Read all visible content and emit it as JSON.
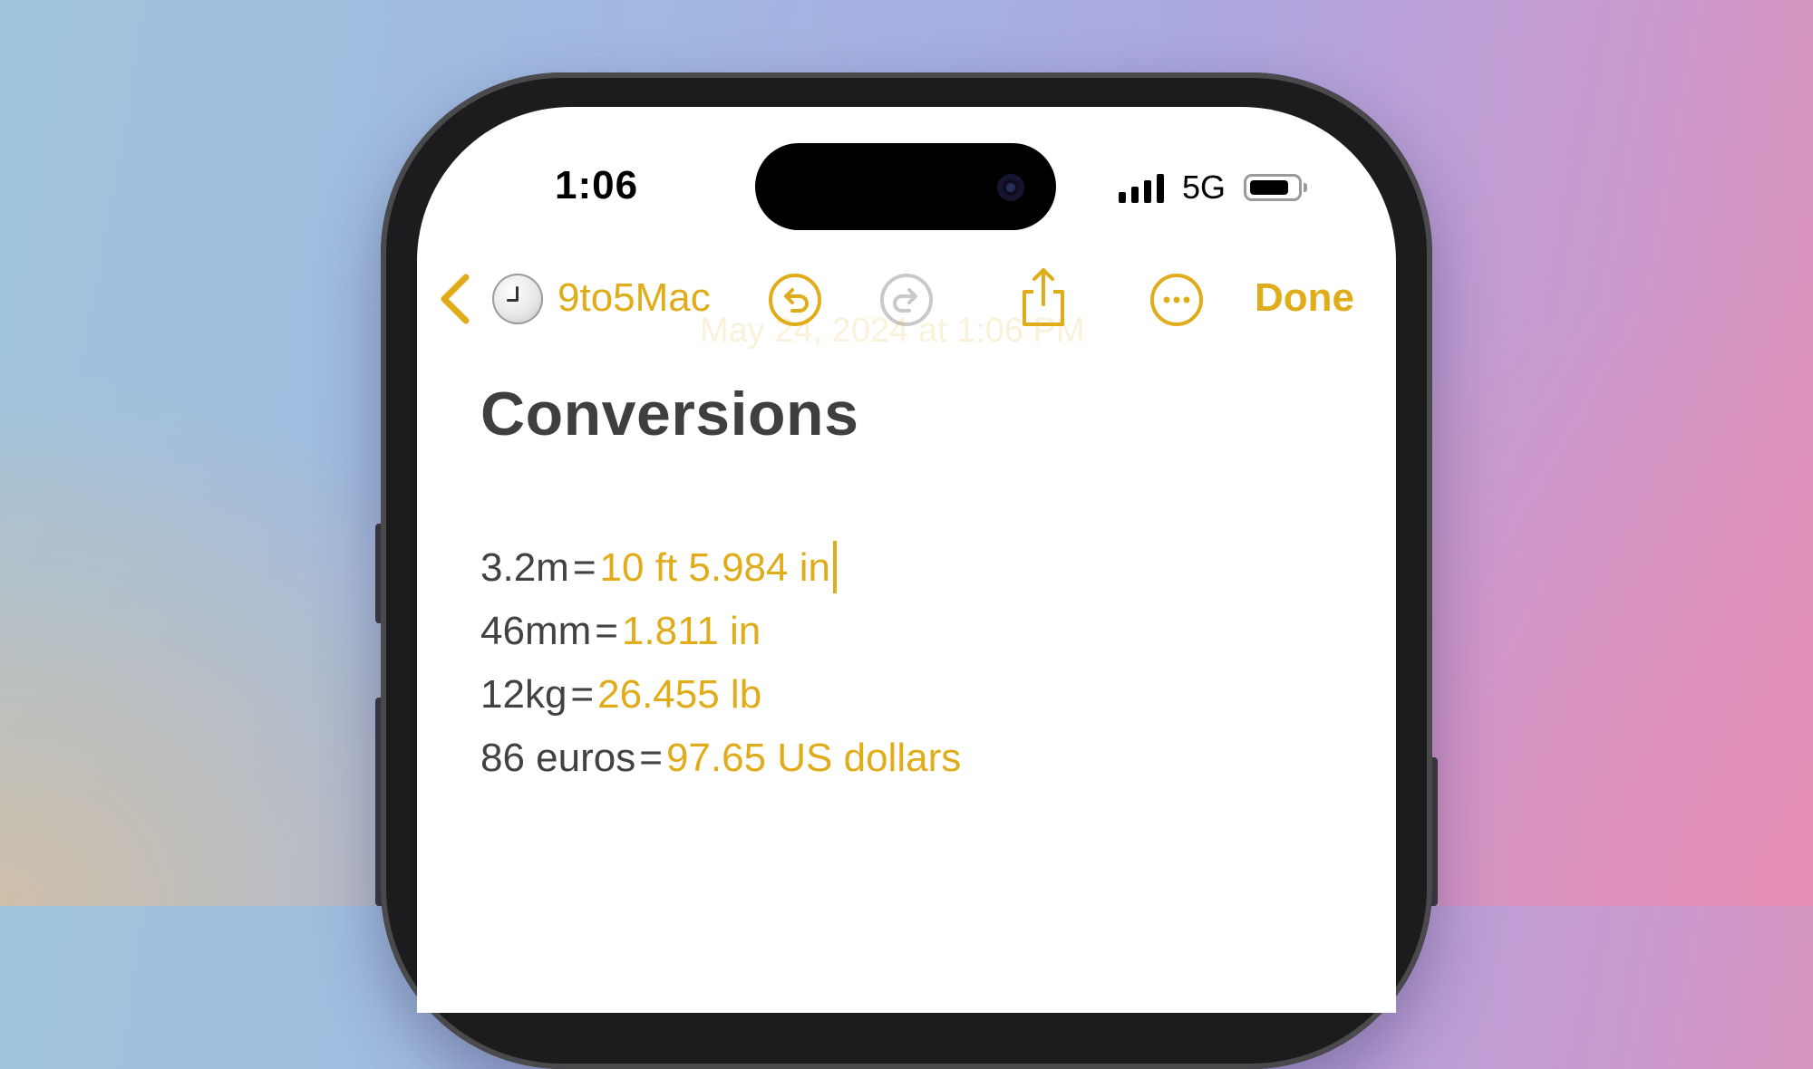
{
  "status_bar": {
    "time": "1:06",
    "network": "5G"
  },
  "toolbar": {
    "folder_label": "9to5Mac",
    "done_label": "Done",
    "icons": [
      "chevron-left-icon",
      "folder-avatar-icon",
      "undo-icon",
      "redo-icon",
      "share-icon",
      "more-icon"
    ]
  },
  "note": {
    "date_line": "May 24, 2024 at 1:06 PM",
    "title": "Conversions",
    "lines": [
      {
        "expression": "3.2m",
        "equals": "=",
        "result": "10 ft 5.984 in"
      },
      {
        "expression": "46mm",
        "equals": "=",
        "result": "1.811 in"
      },
      {
        "expression": "12kg",
        "equals": "=",
        "result": "26.455 lb"
      },
      {
        "expression": "86 euros",
        "equals": "=",
        "result": "97.65 US dollars"
      }
    ]
  },
  "colors": {
    "accent": "#e0ac1a",
    "text": "#424244",
    "title": "#3f3f41"
  }
}
